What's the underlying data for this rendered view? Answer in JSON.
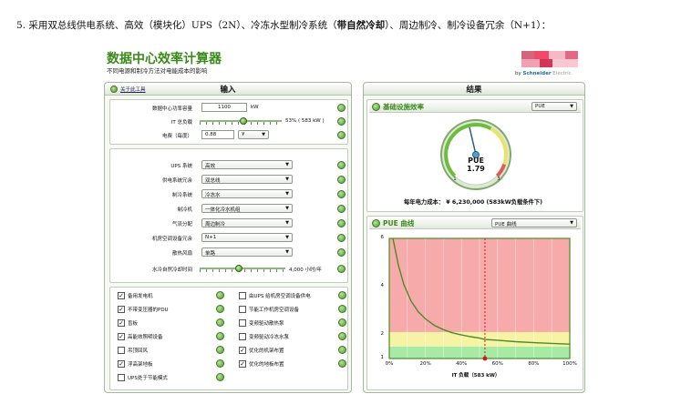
{
  "caption": {
    "prefix": "5.  采用双总线供电系统、高效（模块化）UPS（2N）、冷冻水型制冷系统（",
    "bold": "带自然冷却",
    "suffix": "）、周边制冷、制冷设备冗余（N+1）："
  },
  "app": {
    "title": "数据中心效率计算器",
    "subtitle": "不同电源和制冷方法对电能成本的影响",
    "brand_by": "by ",
    "brand_name": "Schneider",
    "brand_suffix": " Electric"
  },
  "input_panel": {
    "title": "输入",
    "help_link": "关于此工具",
    "fields": [
      {
        "label": "数据中心功率容量",
        "value": "1100",
        "unit": "kW"
      },
      {
        "label": "IT 总负载",
        "readout": "53% ( 583 kW )",
        "level_pct": 53
      },
      {
        "label": "电费（每度）",
        "value": "0.88",
        "currency": "¥"
      }
    ],
    "selects": [
      {
        "label": "UPS 系统",
        "value": "高效"
      },
      {
        "label": "供电系统冗余",
        "value": "双总线"
      },
      {
        "label": "制冷系统",
        "value": "冷冻水"
      },
      {
        "label": "制冷机",
        "value": "一体化冷水机组"
      },
      {
        "label": "气流分配",
        "value": "周边制冷"
      },
      {
        "label": "机房空调设备冗余",
        "value": "N+1"
      },
      {
        "label": "散热风扇",
        "value": "单路"
      }
    ],
    "free_cooling": {
      "label": "水冷自然冷却时间",
      "readout": "4,000 小时/年",
      "level_pct": 46
    },
    "options_left": [
      {
        "label": "备用发电机",
        "checked": true
      },
      {
        "label": "不带变压器的PDU",
        "checked": true
      },
      {
        "label": "盲板",
        "checked": true
      },
      {
        "label": "高能效照明设备",
        "checked": true
      },
      {
        "label": "吊顶回风",
        "checked": false
      },
      {
        "label": "浮高架地板",
        "checked": true
      },
      {
        "label": "UPS处于节能模式",
        "checked": false
      }
    ],
    "options_right": [
      {
        "label": "由UPS 给机房空调设备供电",
        "checked": false
      },
      {
        "label": "节能工作机房空调设备",
        "checked": false
      },
      {
        "label": "变频驱动散热泵",
        "checked": false
      },
      {
        "label": "变频驱动冷冻水泵",
        "checked": false
      },
      {
        "label": "优化的机架布置",
        "checked": true
      },
      {
        "label": "优化的地板布置",
        "checked": true
      }
    ]
  },
  "result_panel": {
    "title": "结果",
    "efficiency": {
      "title": "基础设施效率",
      "metric_select": "PUE",
      "gauge_label": "PUE",
      "gauge_value": "1.79",
      "gauge_min": "1",
      "gauge_max": "3",
      "cost_text": "每年电力成本： ¥ 6,230,000 (583kW负载条件下)"
    },
    "curve": {
      "title": "PUE 曲线",
      "select": "PUE 曲线"
    }
  },
  "chart_data": {
    "type": "line",
    "title": "",
    "xlabel": "IT 负载（583 kW）",
    "ylabel": "",
    "x_ticks": [
      "0%",
      "20%",
      "40%",
      "60%",
      "80%",
      "100%"
    ],
    "y_ticks": [
      "1",
      "2",
      "4",
      "6"
    ],
    "xlim": [
      0,
      100
    ],
    "ylim": [
      1,
      6
    ],
    "zones": [
      {
        "from": 1,
        "to": 1.5,
        "color": "#a6eaa6"
      },
      {
        "from": 1.5,
        "to": 2.1,
        "color": "#f6f4a4"
      },
      {
        "from": 2.1,
        "to": 6,
        "color": "#f7aaaa"
      }
    ],
    "series": [
      {
        "color": "#4e8a2a",
        "x": [
          2,
          5,
          8,
          12,
          16,
          20,
          25,
          30,
          35,
          40,
          45,
          50,
          53,
          60,
          70,
          80,
          90,
          100
        ],
        "y": [
          6.0,
          4.9,
          4.1,
          3.4,
          2.95,
          2.65,
          2.38,
          2.2,
          2.07,
          1.98,
          1.91,
          1.85,
          1.79,
          1.76,
          1.7,
          1.66,
          1.63,
          1.6
        ]
      }
    ],
    "marker": {
      "x": 53,
      "y": 1.79
    },
    "grid": true
  }
}
